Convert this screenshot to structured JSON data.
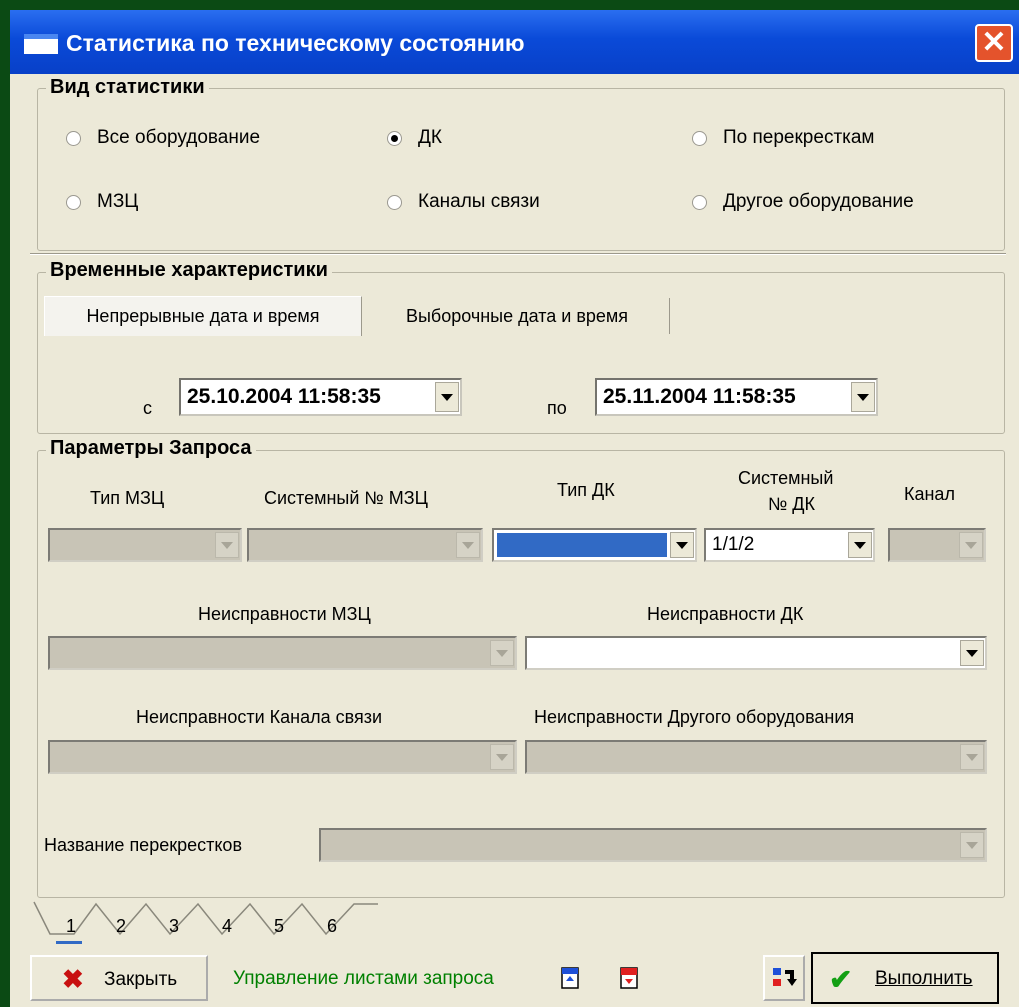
{
  "window": {
    "title": "Статистика по техническому состоянию",
    "close_glyph": "✕"
  },
  "stat_type": {
    "legend": "Вид статистики",
    "options": [
      {
        "label": "Все оборудование",
        "selected": false
      },
      {
        "label": "ДК",
        "selected": true
      },
      {
        "label": "По перекресткам",
        "selected": false
      },
      {
        "label": "МЗЦ",
        "selected": false
      },
      {
        "label": "Каналы связи",
        "selected": false
      },
      {
        "label": "Другое оборудование",
        "selected": false
      }
    ]
  },
  "time": {
    "legend": "Временные характеристики",
    "tabs": [
      "Непрерывные дата и время",
      "Выборочные дата и время"
    ],
    "from_label": "с",
    "from_value": "25.10.2004  11:58:35",
    "to_label": "по",
    "to_value": "25.11.2004  11:58:35"
  },
  "params": {
    "legend": "Параметры Запроса",
    "type_mzc": "Тип МЗЦ",
    "sys_mzc": "Системный № МЗЦ",
    "type_dk": "Тип ДК",
    "sys_dk_line1": "Системный",
    "sys_dk_line2": "№ ДК",
    "channel": "Канал",
    "sys_dk_value": "1/1/2",
    "faults_mzc": "Неисправности МЗЦ",
    "faults_dk": "Неисправности ДК",
    "faults_channel": "Неисправности Канала связи",
    "faults_other": "Неисправности Другого оборудования",
    "intersections": "Название перекрестков"
  },
  "pages": [
    "1",
    "2",
    "3",
    "4",
    "5",
    "6"
  ],
  "bottom": {
    "close_label": "Закрыть",
    "manage_label": "Управление листами запроса",
    "execute_label": "Выполнить"
  },
  "colors": {
    "manage_text": "#008000",
    "title_bar": "#0a4ad8",
    "selection": "#316ac5"
  }
}
